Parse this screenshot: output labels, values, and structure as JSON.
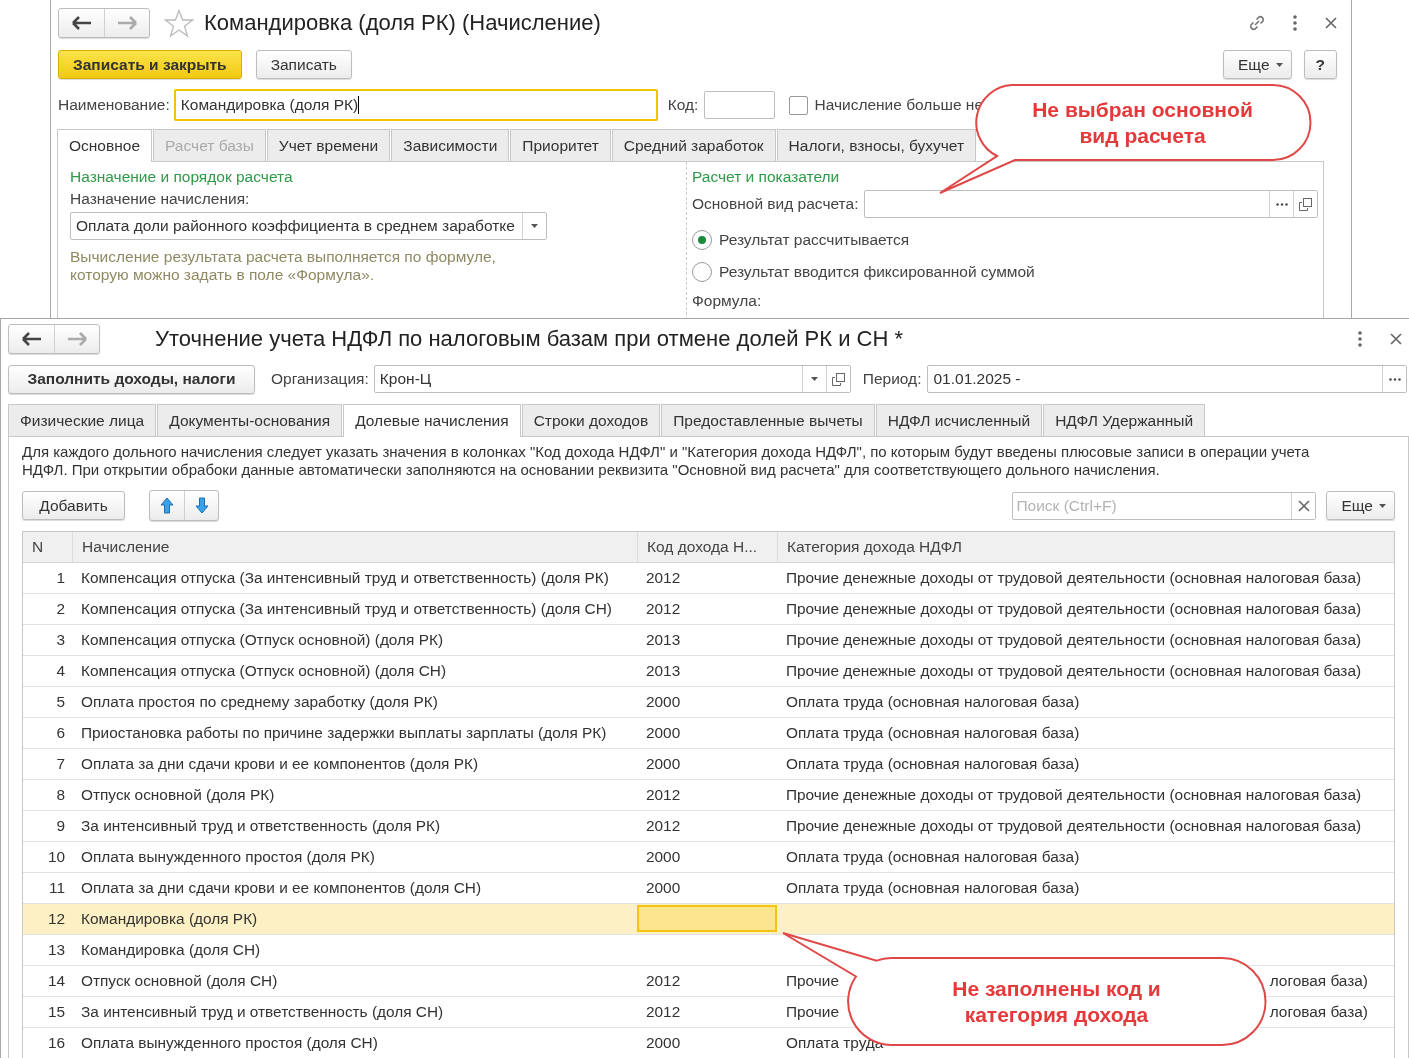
{
  "record_window": {
    "title": "Командировка (доля РК) (Начисление)",
    "buttons": [
      {
        "label": "Записать и закрыть",
        "kind": "primary"
      },
      {
        "label": "Записать",
        "kind": "default"
      }
    ],
    "more_button": "Еще",
    "help_button": "?",
    "name_field": {
      "label": "Наименование:",
      "value": "Командировка (доля РК)",
      "focused": true
    },
    "code_field": {
      "label": "Код:"
    },
    "inactive_checkbox": {
      "label": "Начисление больше не",
      "checked": false
    },
    "tabs": [
      {
        "label": "Основное",
        "selected": true,
        "disabled": false
      },
      {
        "label": "Расчет базы",
        "selected": false,
        "disabled": true
      },
      {
        "label": "Учет времени",
        "selected": false,
        "disabled": false
      },
      {
        "label": "Зависимости",
        "selected": false,
        "disabled": false
      },
      {
        "label": "Приоритет",
        "selected": false,
        "disabled": false
      },
      {
        "label": "Средний заработок",
        "selected": false,
        "disabled": false
      },
      {
        "label": "Налоги, взносы, бухучет",
        "selected": false,
        "disabled": false
      }
    ],
    "left_section": {
      "heading": "Назначение и порядок расчета",
      "purpose_label": "Назначение начисления:",
      "purpose_value": "Оплата доли районного коэффициента в среднем заработке",
      "hint": "Вычисление результата расчета выполняется по формуле, которую можно задать в поле «Формула»."
    },
    "right_section": {
      "heading": "Расчет и показатели",
      "base_type_label": "Основной вид расчета:",
      "radios": [
        {
          "label": "Результат рассчитывается",
          "selected": true
        },
        {
          "label": "Результат вводится фиксированной суммой",
          "selected": false
        }
      ],
      "formula_label": "Формула:"
    }
  },
  "document_window": {
    "title": "Уточнение учета НДФЛ по налоговым базам при отмене долей РК и СН *",
    "fill_button": "Заполнить доходы, налоги",
    "organization": {
      "label": "Организация:",
      "value": "Крон-Ц"
    },
    "period": {
      "label": "Период:",
      "value": "01.01.2025 -"
    },
    "tabs": [
      {
        "label": "Физические лица",
        "selected": false
      },
      {
        "label": "Документы-основания",
        "selected": false
      },
      {
        "label": "Долевые начисления",
        "selected": true
      },
      {
        "label": "Строки доходов",
        "selected": false
      },
      {
        "label": "Предоставленные вычеты",
        "selected": false
      },
      {
        "label": "НДФЛ исчисленный",
        "selected": false
      },
      {
        "label": "НДФЛ Удержанный",
        "selected": false
      }
    ],
    "info": "Для каждого дольного начисления следует указать значения в колонках \"Код дохода НДФЛ\" и \"Категория дохода НДФЛ\", по которым будут введены плюсовые записи в операции учета НДФЛ. При открытии обрабоки данные автоматически заполняются на основании реквизита \"Основной вид расчета\" для соответствующего дольного начисления.",
    "add_button": "Добавить",
    "search": {
      "placeholder": "Поиск (Ctrl+F)"
    },
    "more_button": "Еще",
    "table": {
      "columns": [
        "N",
        "Начисление",
        "Код дохода Н...",
        "Категория дохода НДФЛ"
      ],
      "rows": [
        {
          "n": "1",
          "name": "Компенсация отпуска (За интенсивный труд и ответственность) (доля РК)",
          "code": "2012",
          "category": "Прочие денежные доходы от трудовой деятельности (основная налоговая база)",
          "selected": false
        },
        {
          "n": "2",
          "name": "Компенсация отпуска (За интенсивный труд и ответственность) (доля СН)",
          "code": "2012",
          "category": "Прочие денежные доходы от трудовой деятельности (основная налоговая база)",
          "selected": false
        },
        {
          "n": "3",
          "name": "Компенсация отпуска (Отпуск основной) (доля РК)",
          "code": "2013",
          "category": "Прочие денежные доходы от трудовой деятельности (основная налоговая база)",
          "selected": false
        },
        {
          "n": "4",
          "name": "Компенсация отпуска (Отпуск основной) (доля СН)",
          "code": "2013",
          "category": "Прочие денежные доходы от трудовой деятельности (основная налоговая база)",
          "selected": false
        },
        {
          "n": "5",
          "name": "Оплата простоя по среднему заработку (доля РК)",
          "code": "2000",
          "category": "Оплата труда (основная налоговая база)",
          "selected": false
        },
        {
          "n": "6",
          "name": "Приостановка работы по причине задержки выплаты зарплаты (доля РК)",
          "code": "2000",
          "category": "Оплата труда (основная налоговая база)",
          "selected": false
        },
        {
          "n": "7",
          "name": "Оплата за дни сдачи крови и ее компонентов (доля РК)",
          "code": "2000",
          "category": "Оплата труда (основная налоговая база)",
          "selected": false
        },
        {
          "n": "8",
          "name": "Отпуск основной (доля РК)",
          "code": "2012",
          "category": "Прочие денежные доходы от трудовой деятельности (основная налоговая база)",
          "selected": false
        },
        {
          "n": "9",
          "name": "За интенсивный труд и ответственность (доля РК)",
          "code": "2012",
          "category": "Прочие денежные доходы от трудовой деятельности (основная налоговая база)",
          "selected": false
        },
        {
          "n": "10",
          "name": "Оплата вынужденного простоя (доля РК)",
          "code": "2000",
          "category": "Оплата труда (основная налоговая база)",
          "selected": false
        },
        {
          "n": "11",
          "name": "Оплата за дни сдачи крови и ее компонентов (доля СН)",
          "code": "2000",
          "category": "Оплата труда (основная налоговая база)",
          "selected": false
        },
        {
          "n": "12",
          "name": "Командировка (доля РК)",
          "selected": true
        },
        {
          "n": "13",
          "name": "Командировка (доля СН)",
          "selected": false
        },
        {
          "n": "14",
          "name": "Отпуск основной (доля СН)",
          "code": "2012",
          "category": "Прочие",
          "category_tail": "логовая база)",
          "selected": false
        },
        {
          "n": "15",
          "name": "За интенсивный труд и ответственность (доля СН)",
          "code": "2012",
          "category": "Прочие",
          "category_tail": "логовая база)",
          "selected": false
        },
        {
          "n": "16",
          "name": "Оплата вынужденного простоя (доля СН)",
          "code": "2000",
          "category": "Оплата труда",
          "selected": false
        }
      ]
    }
  },
  "callouts": [
    {
      "text": "Не выбран основной вид расчета"
    },
    {
      "text": "Не заполнены код и категория дохода"
    }
  ]
}
